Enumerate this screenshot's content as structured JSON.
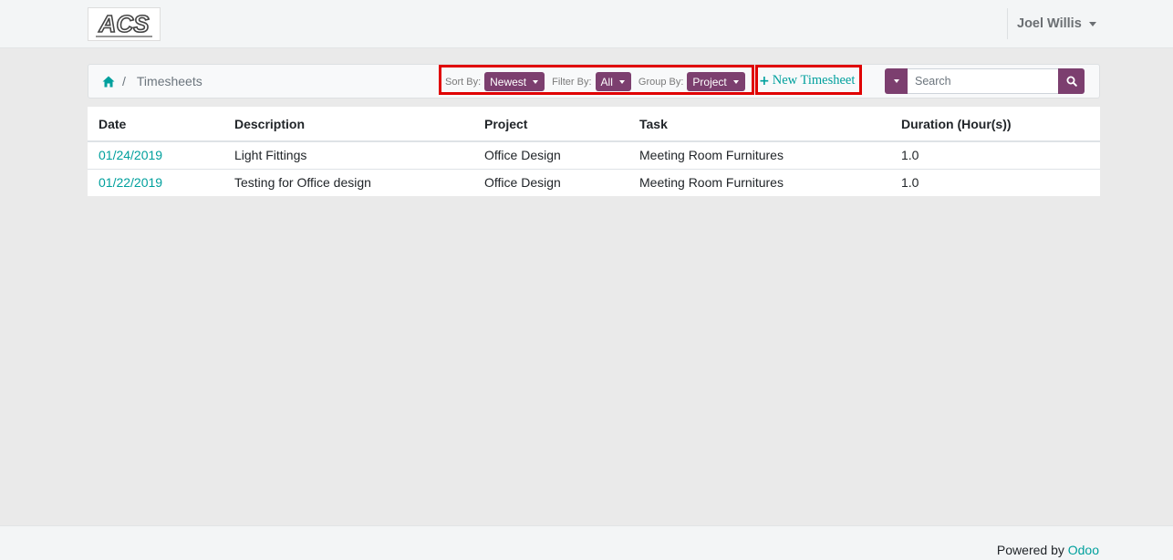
{
  "header": {
    "logo_text": "ACS",
    "user_name": "Joel Willis"
  },
  "breadcrumb": {
    "home_icon": "home-icon",
    "separator": "/",
    "current": "Timesheets"
  },
  "options": {
    "sort_label": "Sort By:",
    "sort_value": "Newest",
    "filter_label": "Filter By:",
    "filter_value": "All",
    "group_label": "Group By:",
    "group_value": "Project"
  },
  "new_timesheet": {
    "icon": "plus-icon",
    "label": "New Timesheet"
  },
  "search": {
    "placeholder": "Search",
    "dropdown_icon": "caret-down-icon",
    "button_icon": "search-icon"
  },
  "table": {
    "headers": [
      "Date",
      "Description",
      "Project",
      "Task",
      "Duration (Hour(s))"
    ],
    "rows": [
      {
        "date": "01/24/2019",
        "description": "Light Fittings",
        "project": "Office Design",
        "task": "Meeting Room Furnitures",
        "duration": "1.0"
      },
      {
        "date": "01/22/2019",
        "description": "Testing for Office design",
        "project": "Office Design",
        "task": "Meeting Room Furnitures",
        "duration": "1.0"
      }
    ]
  },
  "footer": {
    "powered_by": "Powered by",
    "brand": "Odoo"
  },
  "colors": {
    "primary": "#7c3f6f",
    "link": "#00a09d",
    "highlight": "#e00000",
    "page_bg": "#eaeaea"
  }
}
